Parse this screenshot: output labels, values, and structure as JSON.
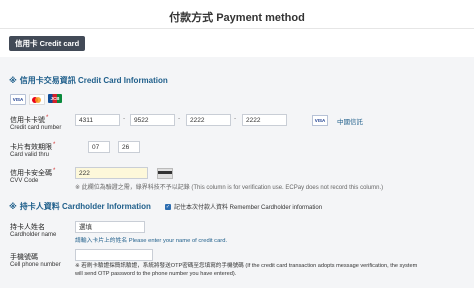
{
  "page_title": "付款方式 Payment method",
  "tab_label": "信用卡 Credit card",
  "card_section": {
    "header": "信用卡交易資訊 Credit Card Information",
    "logos": [
      "VISA",
      "MC",
      "JCB"
    ],
    "card_number_label_zh": "信用卡卡號",
    "card_number_label_en": "Credit card number",
    "card_number": [
      "4311",
      "9522",
      "2222",
      "2222"
    ],
    "card_brand_badge": "VISA",
    "issuing_bank": "中國信託",
    "valid_thru_label_zh": "卡片有效期限",
    "valid_thru_label_en": "Card valid thru",
    "valid_month": "07",
    "valid_year": "26",
    "cvv_label_zh": "信用卡安全碼",
    "cvv_label_en": "CVV Code",
    "cvv_value": "222",
    "cvv_note": "※ 此欄位為驗證之需，綠界科技不予以記錄 (This column is for verification use. ECPay does not record this column.)"
  },
  "holder_section": {
    "header": "持卡人資料 Cardholder Information",
    "remember_label": "記住本次付款人資料 Remember Cardholder information",
    "name_label_zh": "持卡人姓名",
    "name_label_en": "Cardholder name",
    "name_value": "選填",
    "name_hint": "請輸入卡片上的姓名 Please enter your name of credit card.",
    "phone_label_zh": "手機號碼",
    "phone_label_en": "Cell phone number",
    "phone_note_1": "※ 若刷卡驗證採簡訊驗證，系統將發送OTP密碼至您填寫的手機號碼 (If the credit card transaction adopts message verification, the system",
    "phone_note_2": "will send OTP password to the phone number you have entered)."
  }
}
